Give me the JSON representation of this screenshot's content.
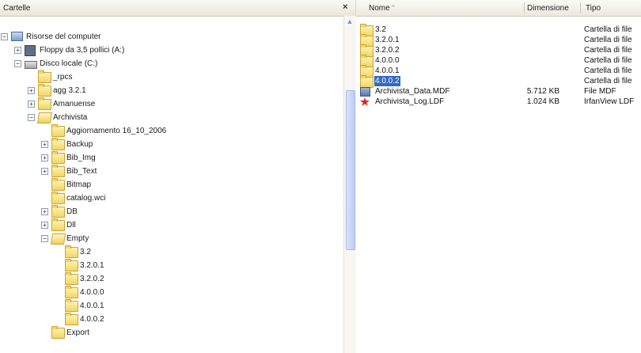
{
  "left_pane": {
    "title": "Cartelle",
    "close_label": "×",
    "tree": [
      {
        "label": "Risorse del computer",
        "icon": "computer-icon",
        "expander": "−"
      },
      {
        "label": "Floppy da 3,5 pollici (A:)",
        "icon": "floppy-icon",
        "expander": "+"
      },
      {
        "label": "Disco locale (C:)",
        "icon": "drive-icon",
        "expander": "−"
      },
      {
        "label": "_rpcs",
        "icon": "folder-icon",
        "expander": ""
      },
      {
        "label": "agg 3.2.1",
        "icon": "folder-icon",
        "expander": "+"
      },
      {
        "label": "Amanuense",
        "icon": "folder-icon",
        "expander": "+"
      },
      {
        "label": "Archivista",
        "icon": "folder-open-icon",
        "expander": "−"
      },
      {
        "label": "Aggiornamento 16_10_2006",
        "icon": "folder-icon",
        "expander": ""
      },
      {
        "label": "Backup",
        "icon": "folder-icon",
        "expander": "+"
      },
      {
        "label": "Bib_Img",
        "icon": "folder-icon",
        "expander": "+"
      },
      {
        "label": "Bib_Text",
        "icon": "folder-icon",
        "expander": "+"
      },
      {
        "label": "Bitmap",
        "icon": "folder-icon",
        "expander": ""
      },
      {
        "label": "catalog.wci",
        "icon": "folder-icon",
        "expander": ""
      },
      {
        "label": "DB",
        "icon": "folder-icon",
        "expander": "+"
      },
      {
        "label": "Dll",
        "icon": "folder-icon",
        "expander": "+"
      },
      {
        "label": "Empty",
        "icon": "folder-open-icon",
        "expander": "−"
      },
      {
        "label": "3.2",
        "icon": "folder-icon",
        "expander": ""
      },
      {
        "label": "3.2.0.1",
        "icon": "folder-icon",
        "expander": ""
      },
      {
        "label": "3.2.0.2",
        "icon": "folder-icon",
        "expander": ""
      },
      {
        "label": "4.0.0.0",
        "icon": "folder-icon",
        "expander": ""
      },
      {
        "label": "4.0.0.1",
        "icon": "folder-icon",
        "expander": ""
      },
      {
        "label": "4.0.0.2",
        "icon": "folder-icon",
        "expander": ""
      },
      {
        "label": "Export",
        "icon": "folder-icon",
        "expander": ""
      }
    ]
  },
  "list": {
    "columns": {
      "name": "Nome",
      "size": "Dimensione",
      "type": "Tipo"
    },
    "rows": [
      {
        "name": "3.2",
        "size": "",
        "type": "Cartella di file",
        "icon": "folder-icon",
        "selected": false
      },
      {
        "name": "3.2.0.1",
        "size": "",
        "type": "Cartella di file",
        "icon": "folder-icon",
        "selected": false
      },
      {
        "name": "3.2.0.2",
        "size": "",
        "type": "Cartella di file",
        "icon": "folder-icon",
        "selected": false
      },
      {
        "name": "4.0.0.0",
        "size": "",
        "type": "Cartella di file",
        "icon": "folder-icon",
        "selected": false
      },
      {
        "name": "4.0.0.1",
        "size": "",
        "type": "Cartella di file",
        "icon": "folder-icon",
        "selected": false
      },
      {
        "name": "4.0.0.2",
        "size": "",
        "type": "Cartella di file",
        "icon": "folder-icon",
        "selected": true
      },
      {
        "name": "Archivista_Data.MDF",
        "size": "5.712 KB",
        "type": "File MDF",
        "icon": "mdf-icon",
        "selected": false
      },
      {
        "name": "Archivista_Log.LDF",
        "size": "1.024 KB",
        "type": "IrfanView LDF",
        "icon": "ldf-icon",
        "selected": false
      }
    ]
  },
  "colors": {
    "selection": "#316ac5",
    "folder": "#f3d565",
    "scroll_thumb": "#c6d5f6"
  }
}
